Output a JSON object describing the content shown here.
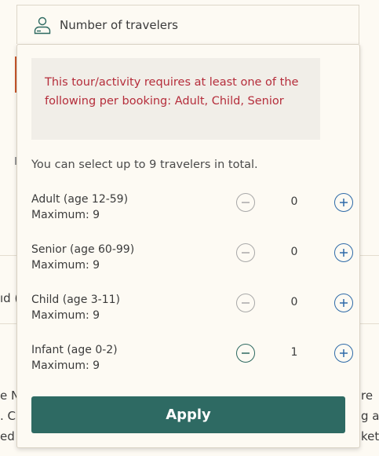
{
  "travelers_field": {
    "label": "Number of travelers",
    "icon": "person-icon"
  },
  "panel": {
    "alert": "This tour/activity requires at least one of the following per booking: Adult, Child, Senior",
    "hint": "You can select up to 9 travelers in total.",
    "rows": [
      {
        "label": "Adult (age 12-59)",
        "max": "Maximum: 9",
        "count": "0",
        "minus_enabled": false
      },
      {
        "label": "Senior (age 60-99)",
        "max": "Maximum: 9",
        "count": "0",
        "minus_enabled": false
      },
      {
        "label": "Child (age 3-11)",
        "max": "Maximum: 9",
        "count": "0",
        "minus_enabled": false
      },
      {
        "label": "Infant (age 0-2)",
        "max": "Maximum: 9",
        "count": "1",
        "minus_enabled": true
      }
    ],
    "apply_label": "Apply"
  },
  "background_fragments": {
    "left_mid": "ıd (",
    "left_1": "e N",
    "left_2": ". C",
    "left_3": "ed",
    "right_1": "re",
    "right_2": "g a",
    "right_3": "ket"
  },
  "colors": {
    "alert_text": "#b52d3b",
    "alert_bg": "#f1eee8",
    "apply_bg": "#2e6a63",
    "plus_button": "#2e6aa8",
    "minus_enabled": "#2d6960",
    "minus_disabled": "#a8a8a8",
    "page_bg": "#fdfaf3"
  }
}
